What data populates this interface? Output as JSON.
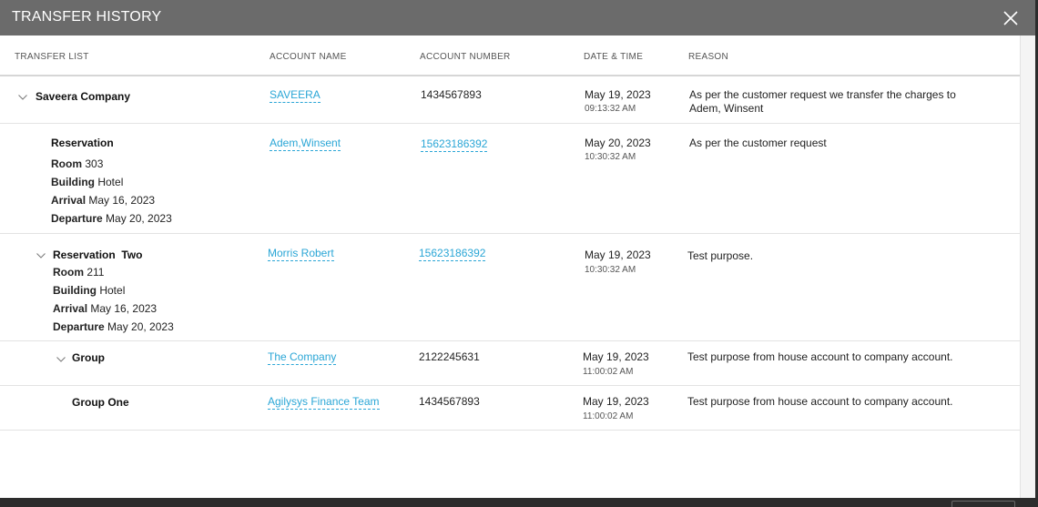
{
  "dialog": {
    "title": "TRANSFER HISTORY"
  },
  "columns": {
    "transfer_list": "TRANSFER LIST",
    "account_name": "ACCOUNT NAME",
    "account_number": "ACCOUNT NUMBER",
    "date_time": "DATE & TIME",
    "reason": "REASON"
  },
  "labels": {
    "room": "Room",
    "building": "Building",
    "arrival": "Arrival",
    "departure": "Departure"
  },
  "rows": [
    {
      "name": "Saveera Company",
      "account_name": "SAVEERA",
      "account_number": "1434567893",
      "date": "May 19, 2023",
      "time": "09:13:32 AM",
      "reason": "As per the customer request we transfer the charges to Adem, Winsent"
    },
    {
      "name": "Reservation",
      "room": "303",
      "building": "Hotel",
      "arrival": "May 16, 2023",
      "departure": "May 20, 2023",
      "account_name": "Adem,Winsent",
      "account_number": "15623186392",
      "date": "May 20, 2023",
      "time": "10:30:32 AM",
      "reason": "As per the customer request"
    },
    {
      "name": "Reservation  Two",
      "room": "211",
      "building": "Hotel",
      "arrival": "May 16, 2023",
      "departure": "May 20, 2023",
      "account_name": "Morris Robert",
      "account_number": "15623186392",
      "date": "May 19, 2023",
      "time": "10:30:32 AM",
      "reason": "Test purpose."
    },
    {
      "name": "Group",
      "account_name": "The Company",
      "account_number": "2122245631",
      "date": "May 19, 2023",
      "time": "11:00:02 AM",
      "reason": "Test purpose from house account to company account."
    },
    {
      "name": "Group One",
      "account_name": "Agilysys Finance Team",
      "account_number": "1434567893",
      "date": "May 19, 2023",
      "time": "11:00:02 AM",
      "reason": "Test purpose from house account to company account."
    }
  ],
  "icons": {
    "close": "close-icon",
    "expand": "chevron-down-icon"
  },
  "colors": {
    "titlebar": "#6b6b6b",
    "link": "#2aa6d6"
  }
}
